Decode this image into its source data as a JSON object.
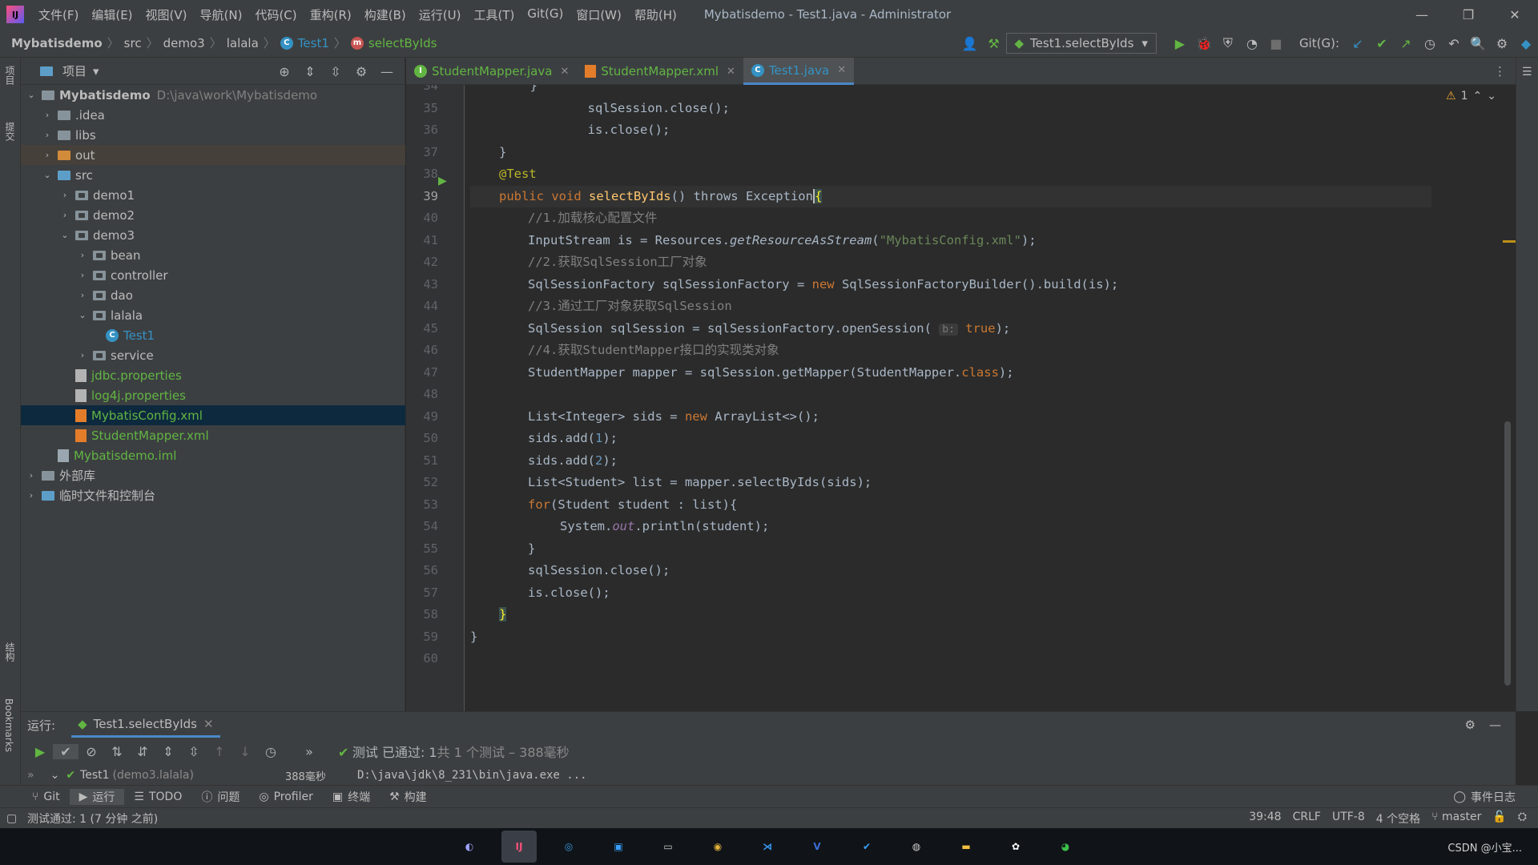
{
  "titlebar": {
    "menu": [
      "文件(F)",
      "编辑(E)",
      "视图(V)",
      "导航(N)",
      "代码(C)",
      "重构(R)",
      "构建(B)",
      "运行(U)",
      "工具(T)",
      "Git(G)",
      "窗口(W)",
      "帮助(H)"
    ],
    "window_title": "Mybatisdemo - Test1.java - Administrator",
    "app_logo": "IJ"
  },
  "navbar": {
    "crumbs": [
      "Mybatisdemo",
      "src",
      "demo3",
      "lalala",
      "Test1",
      "selectByIds"
    ],
    "run_config": "Test1.selectByIds",
    "git_label": "Git(G):"
  },
  "leftstrip": {
    "project": "项目",
    "commit": "提交",
    "structure": "结构",
    "bookmarks": "Bookmarks"
  },
  "project": {
    "title": "项目",
    "tree": [
      {
        "label": "Mybatisdemo",
        "path": "D:\\java\\work\\Mybatisdemo"
      },
      {
        "label": ".idea"
      },
      {
        "label": "libs"
      },
      {
        "label": "out"
      },
      {
        "label": "src"
      },
      {
        "label": "demo1"
      },
      {
        "label": "demo2"
      },
      {
        "label": "demo3"
      },
      {
        "label": "bean"
      },
      {
        "label": "controller"
      },
      {
        "label": "dao"
      },
      {
        "label": "lalala"
      },
      {
        "label": "Test1"
      },
      {
        "label": "service"
      },
      {
        "label": "jdbc.properties"
      },
      {
        "label": "log4j.properties"
      },
      {
        "label": "MybatisConfig.xml"
      },
      {
        "label": "StudentMapper.xml"
      },
      {
        "label": "Mybatisdemo.iml"
      },
      {
        "label": "外部库"
      },
      {
        "label": "临时文件和控制台"
      }
    ]
  },
  "tabs": [
    {
      "label": "StudentMapper.java"
    },
    {
      "label": "StudentMapper.xml"
    },
    {
      "label": "Test1.java"
    }
  ],
  "editor": {
    "warnings": "1",
    "line_numbers": [
      "34",
      "35",
      "36",
      "37",
      "38",
      "39",
      "40",
      "41",
      "42",
      "43",
      "44",
      "45",
      "46",
      "47",
      "48",
      "49",
      "50",
      "51",
      "52",
      "53",
      "54",
      "55",
      "56",
      "57",
      "58",
      "59",
      "60"
    ],
    "code": {
      "l34": "        }",
      "l35": "        sqlSession.close();",
      "l36": "        is.close();",
      "l37": "    }",
      "l38": "@Test",
      "l39a": "public void ",
      "l39b": "selectByIds",
      "l39c": "() throws Exception",
      "l40": "//1.加载核心配置文件",
      "l41a": "InputStream is = Resources.",
      "l41b": "getResourceAsStream",
      "l41c": "(",
      "l41d": "\"MybatisConfig.xml\"",
      "l41e": ");",
      "l42": "//2.获取SqlSession工厂对象",
      "l43a": "SqlSessionFactory sqlSessionFactory = ",
      "l43b": "new ",
      "l43c": "SqlSessionFactoryBuilder().build(is);",
      "l44": "//3.通过工厂对象获取SqlSession",
      "l45a": "SqlSession sqlSession = sqlSessionFactory.openSession( ",
      "l45b": "b:",
      "l45c": " true",
      "l45d": ");",
      "l46": "//4.获取StudentMapper接口的实现类对象",
      "l47a": "StudentMapper mapper = sqlSession.getMapper(StudentMapper.",
      "l47b": "class",
      "l47c": ");",
      "l49a": "List<Integer> sids = ",
      "l49b": "new ",
      "l49c": "ArrayList<>();",
      "l50a": "sids.add(",
      "l50b": "1",
      "l50c": ");",
      "l51a": "sids.add(",
      "l51b": "2",
      "l51c": ");",
      "l52": "List<Student> list = mapper.selectByIds(sids);",
      "l53a": "for",
      "l53b": "(Student student : list){",
      "l54a": "System.",
      "l54b": "out",
      "l54c": ".println(student);",
      "l55": "}",
      "l56": "sqlSession.close();",
      "l57": "is.close();",
      "l58": "}",
      "l59": "}"
    }
  },
  "runpanel": {
    "label": "运行:",
    "tab": "Test1.selectByIds",
    "status_strong": "测试 已通过: 1",
    "status_rest": "共 1 个测试 – 388毫秒",
    "test_row": "Test1",
    "test_pkg": "(demo3.lalala)",
    "test_time": "388毫秒",
    "console": "D:\\java\\jdk\\8_231\\bin\\java.exe ..."
  },
  "toolwindows": [
    "Git",
    "运行",
    "TODO",
    "问题",
    "Profiler",
    "终端",
    "构建"
  ],
  "event_log": "事件日志",
  "statusbar": {
    "message": "测试通过: 1 (7 分钟 之前)",
    "position": "39:48",
    "line_sep": "CRLF",
    "encoding": "UTF-8",
    "indent": "4 个空格",
    "branch": "master"
  },
  "taskbar": {
    "tray": "CSDN @小宝..."
  },
  "colors": {
    "accent": "#4a88c7",
    "keyword": "#cc7832",
    "string": "#6a8759",
    "function": "#ffc66d",
    "comment": "#808080",
    "pass": "#62b543"
  }
}
